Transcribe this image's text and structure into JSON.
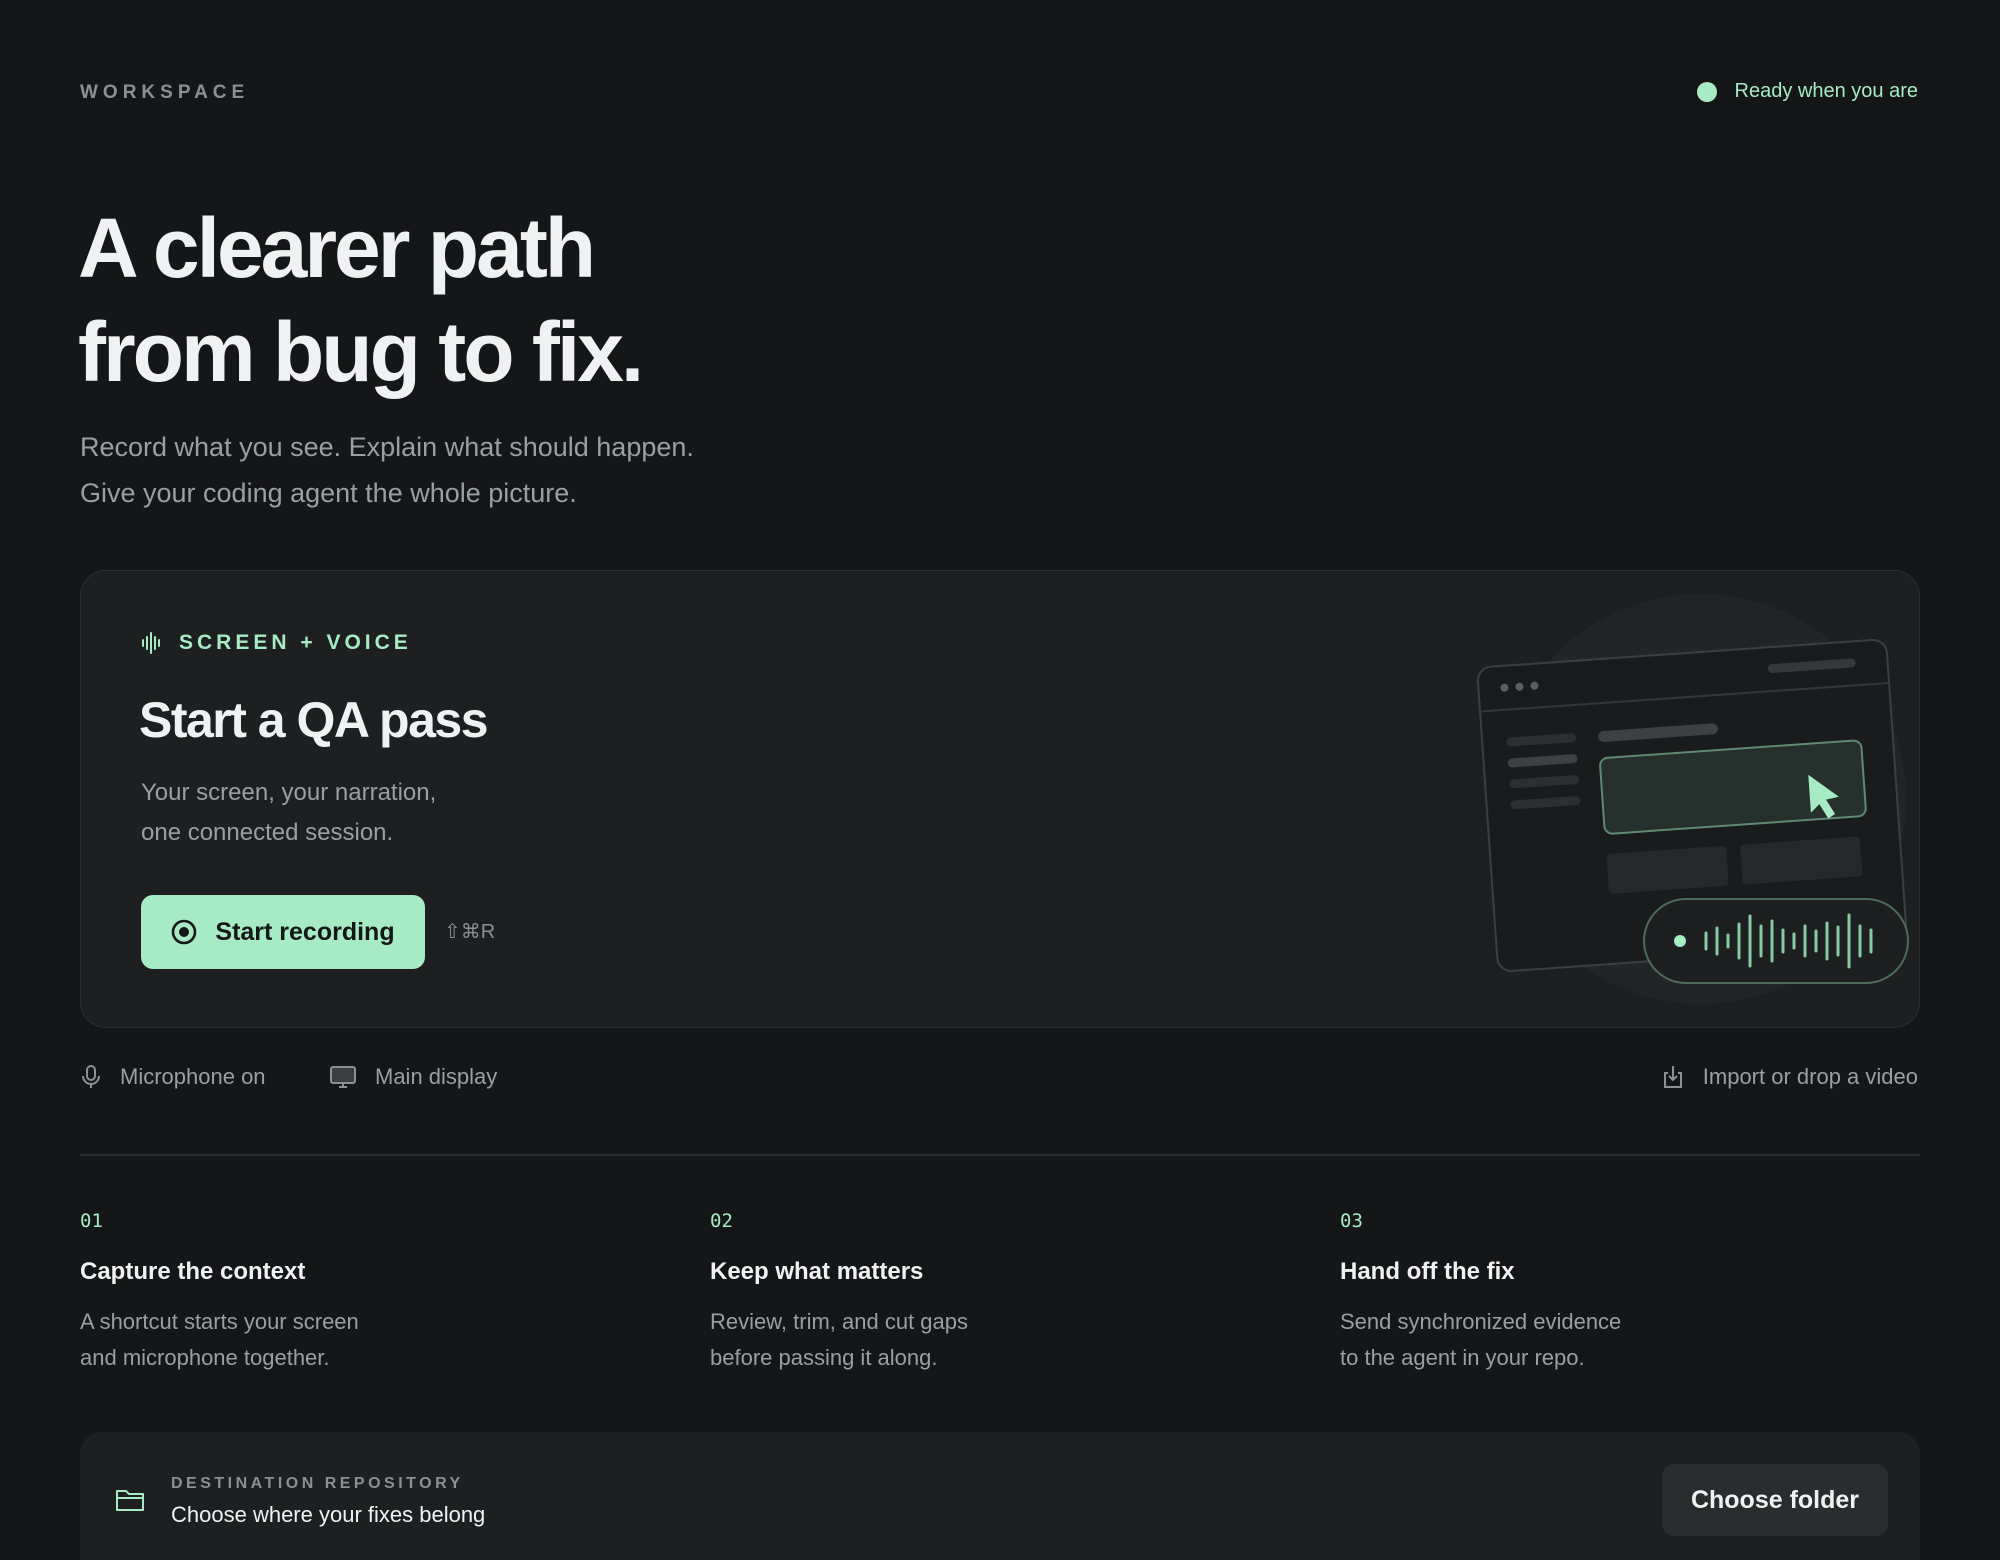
{
  "header": {
    "eyebrow": "WORKSPACE",
    "status": "Ready when you are"
  },
  "hero": {
    "title_line1": "A clearer path",
    "title_line2": "from bug to fix.",
    "subtitle_line1": "Record what you see. Explain what should happen.",
    "subtitle_line2": "Give your coding agent the whole picture."
  },
  "card": {
    "eyebrow": "SCREEN + VOICE",
    "title": "Start a QA pass",
    "subtitle_line1": "Your screen, your narration,",
    "subtitle_line2": "one connected session.",
    "record_label": "Start recording",
    "shortcut": "⇧⌘R"
  },
  "options": {
    "microphone": "Microphone on",
    "display": "Main display",
    "import": "Import or drop a video"
  },
  "steps": [
    {
      "num": "01",
      "title": "Capture the context",
      "desc_line1": "A shortcut starts your screen",
      "desc_line2": "and microphone together."
    },
    {
      "num": "02",
      "title": "Keep what matters",
      "desc_line1": "Review, trim, and cut gaps",
      "desc_line2": "before passing it along."
    },
    {
      "num": "03",
      "title": "Hand off the fix",
      "desc_line1": "Send synchronized evidence",
      "desc_line2": "to the agent in your repo."
    }
  ],
  "destination": {
    "label": "DESTINATION REPOSITORY",
    "text": "Choose where your fixes belong",
    "button": "Choose folder"
  },
  "colors": {
    "accent": "#a6ebc3",
    "background": "#151618",
    "card": "#1d1f21",
    "muted_text": "#9a9fa3"
  },
  "icons": {
    "status": "status-dot-icon",
    "eyebrow": "waveform-icon",
    "record": "record-icon",
    "microphone": "microphone-icon",
    "display": "monitor-icon",
    "import": "import-icon",
    "destination": "folder-icon"
  }
}
